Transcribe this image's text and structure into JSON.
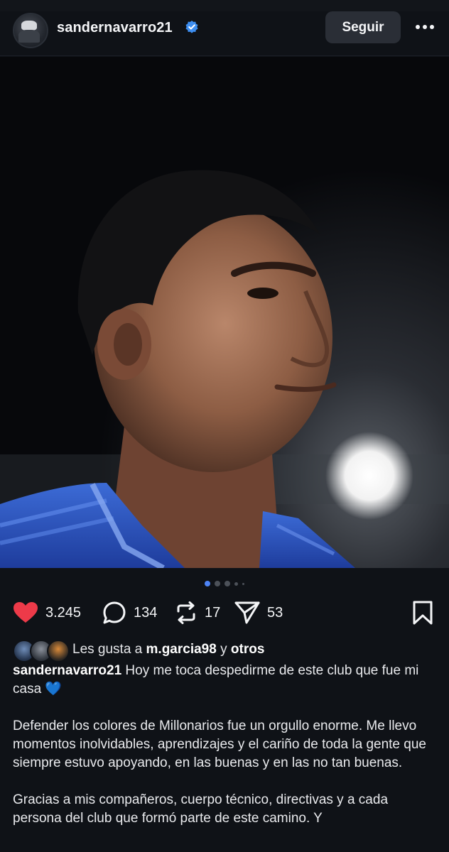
{
  "header": {
    "username": "sandernavarro21",
    "follow_label": "Seguir",
    "more_label": "•••",
    "verified_icon": "verified-badge-icon"
  },
  "carousel": {
    "total_slides": 5,
    "active_index": 0
  },
  "actions": {
    "likes": "3.245",
    "comments": "134",
    "reposts": "17",
    "shares": "53",
    "like_color": "#ed3a49"
  },
  "liked_by": {
    "prefix": "Les gusta a ",
    "user": "m.garcia98",
    "connector": " y ",
    "others": "otros"
  },
  "caption": {
    "username": "sandernavarro21",
    "line1": " Hoy me toca despedirme de este club que fue mi casa ",
    "emoji": "💙",
    "para2": "Defender los colores de Millonarios fue un orgullo enorme. Me llevo momentos inolvidables, aprendizajes y el cariño de toda la gente que siempre estuvo apoyando, en las buenas y en las no tan buenas.",
    "para3": "Gracias a mis compañeros, cuerpo técnico, directivas y a cada persona del club que formó parte de este camino. Y"
  },
  "colors": {
    "background": "#0f1217",
    "accent_blue": "#4d83f5",
    "button_bg": "#2a2e36"
  }
}
